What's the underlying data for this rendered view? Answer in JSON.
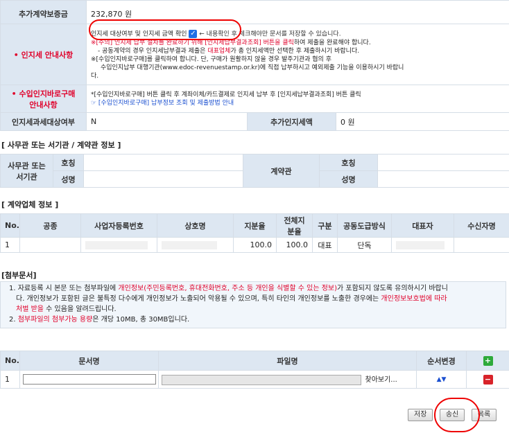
{
  "info": {
    "add_guarantee_label": "추가계약보증금",
    "add_guarantee_value": "232,870 원",
    "stamp_notice_label": "인지세 안내사항",
    "stamp_check_text": "인지세 대상여부 및 인지세 금액 확인",
    "stamp_check_hint": "← 내용확인 후 체크해야만 문서를 저장할 수 있습니다.",
    "notice_line1_a": "※[주의] 인지세 납부 절차를 완료하기 위해 ",
    "notice_line1_b": "[인지세납부결과조회]",
    "notice_line1_c": " 버튼을 클릭",
    "notice_line1_d": "하여 제출을 완료해야 합니다.",
    "notice_line2_a": "- 공동계약의 경우 인지세납부결과 제출은 ",
    "notice_line2_b": "대표업체",
    "notice_line2_c": "가 총 인지세액만 선택한 후 제출하시기 바랍니다.",
    "notice_line3": "※[수입인지바로구매]를 클릭하여 합니다. 단, 구매가 원활하지 않을 경우 발주기관과 협의 후",
    "notice_line4": "수입인지납부 대행기관(www.edoc-revenuestamp.or.kr)에 직접 납부하시고 예외제출 기능을 이용하시기 바랍니",
    "notice_line5": "다.",
    "revenue_label_1": "수입인지바로구매",
    "revenue_label_2": "안내사항",
    "revenue_line1": "*[수입인지바로구매] 버튼 클릭 후 계좌이체/카드결제로 인지세 납부 후 [인지세납부결과조회] 버튼 클릭",
    "revenue_line2": "☞ [수입인지바로구매] 납부정보 조회 및 제출방법 안내",
    "stamp_tax_target_label": "인지세과세대상여부",
    "stamp_tax_target_value": "N",
    "add_stamp_label": "추가인지세액",
    "add_stamp_value": "0 원"
  },
  "officer": {
    "section_title": "[ 사무관 또는 서기관 / 계약관 정보 ]",
    "officer_label_1": "사무관 또는",
    "officer_label_2": "서기관",
    "title_label": "호칭",
    "name_label": "성명",
    "contract_officer_label": "계약관"
  },
  "company": {
    "section_title": "[ 계약업체 정보 ]",
    "headers": [
      "No.",
      "공종",
      "사업자등록번호",
      "상호명",
      "지분율",
      "전체지분율",
      "구분",
      "공동도급방식",
      "대표자",
      "수신자명"
    ],
    "rows": [
      {
        "no": "1",
        "share": "100.0",
        "total_share": "100.0",
        "type": "대표",
        "method": "단독"
      }
    ]
  },
  "attach": {
    "section_title": "[첨부문서]",
    "note1_a": "1. 자료등록 시 본문 또는 첨부파일에 ",
    "note1_b": "개인정보(주민등록번호, 휴대전화번호, 주소 등 개인을 식별할 수 있는 정보)",
    "note1_c": "가 포함되지 않도록 유의하시기 바랍니",
    "note1_d": "다. 개인정보가 포함된 글은 불특정 다수에게 개인정보가 노출되어 악용될 수 있으며, 특히 타인의 개인정보를 노출한 경우에는 ",
    "note1_e": "개인정보보호법에 따라",
    "note1_f": "처벌 받을",
    "note1_g": " 수 있음을 알려드립니다.",
    "note2_a": "2. ",
    "note2_b": "첨부파일의 첨부가능 용량",
    "note2_c": "은 개당 10MB, 총 30MB입니다.",
    "headers": [
      "No.",
      "문서명",
      "파일명",
      "순서변경"
    ],
    "row_no": "1",
    "browse_label": "찾아보기...",
    "add_icon_glyph": "+",
    "remove_icon_glyph": "−",
    "order_glyph": "▲▼"
  },
  "buttons": {
    "save": "저장",
    "send": "송신",
    "list": "목록"
  },
  "check_glyph": "✓",
  "colors": {
    "label_bg": "#dde7f2",
    "red": "#e0002a",
    "blue": "#1a4fd0",
    "add": "#2eaa3a",
    "remove": "#d8232a"
  }
}
